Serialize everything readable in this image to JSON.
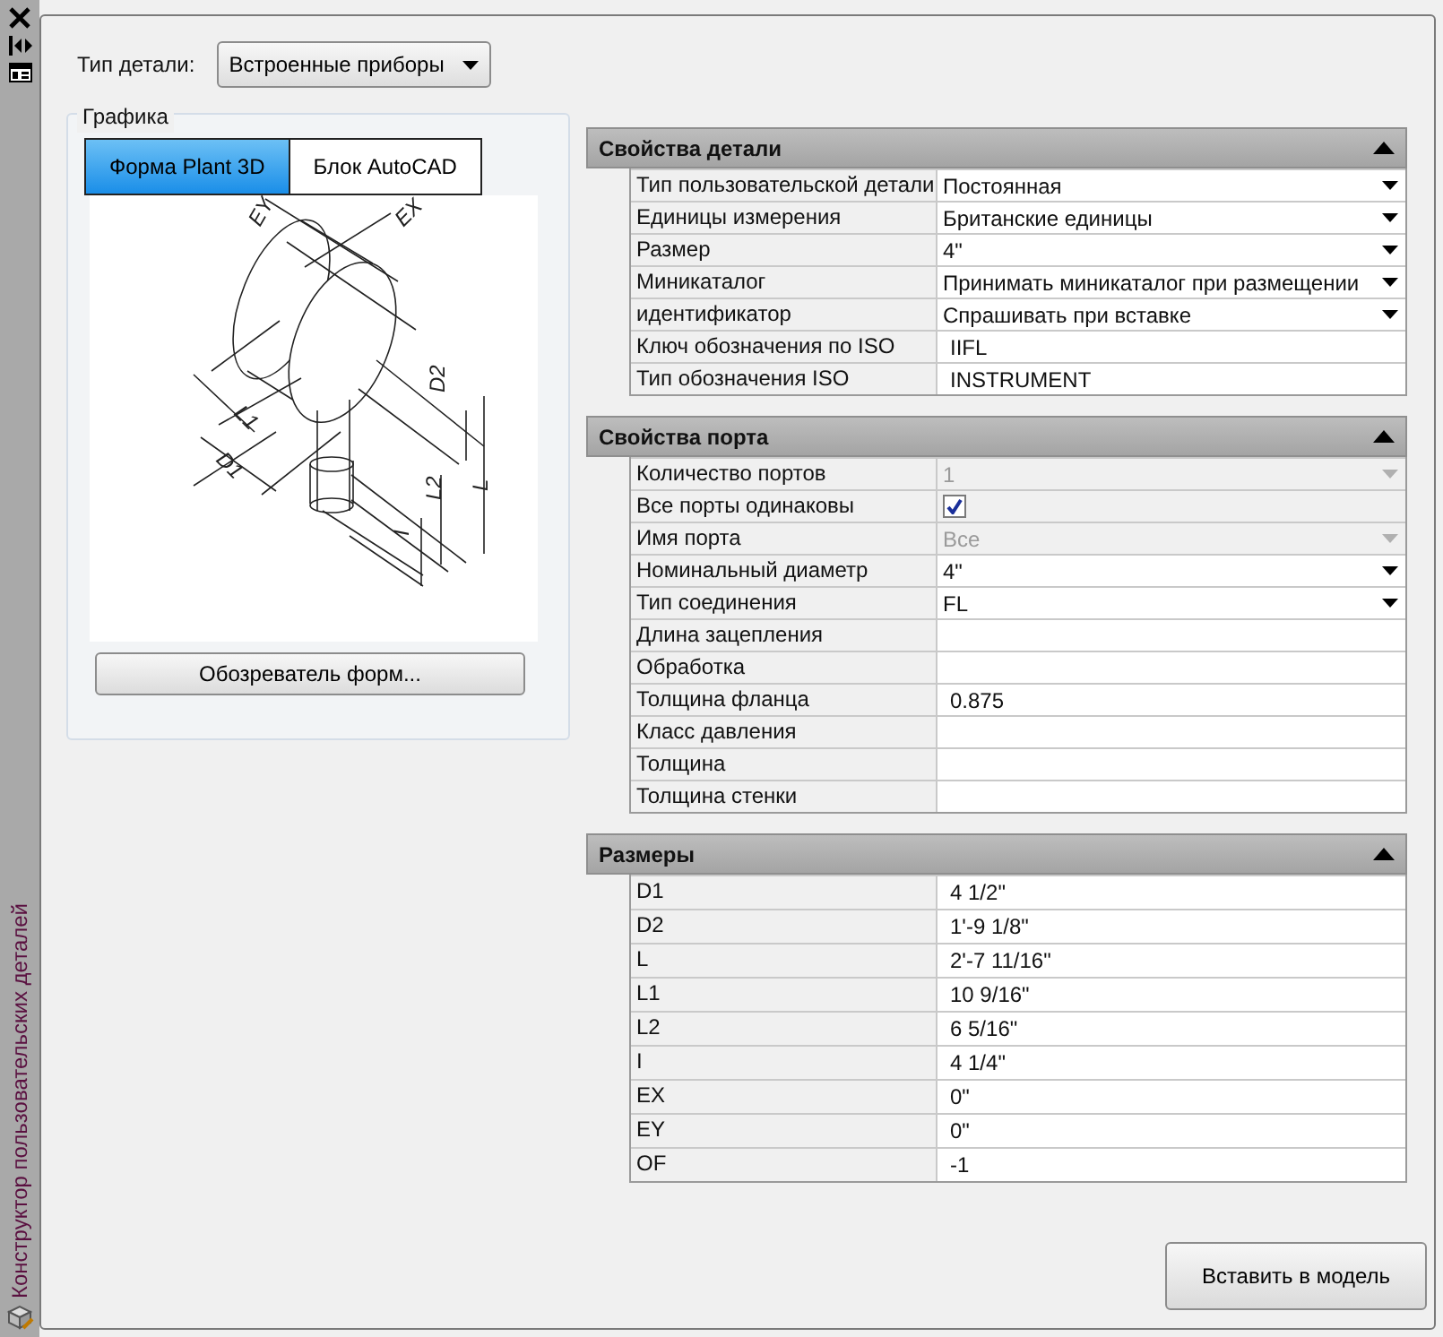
{
  "side_panel": {
    "title": "Конструктор пользовательских деталей"
  },
  "part_type": {
    "label": "Тип детали:",
    "value": "Встроенные приборы"
  },
  "graphics": {
    "title": "Графика",
    "tabs": [
      {
        "label": "Форма Plant 3D",
        "selected": true
      },
      {
        "label": "Блок AutoCAD",
        "selected": false
      }
    ],
    "dimension_labels": [
      "EY",
      "EX",
      "L1",
      "D1",
      "D2",
      "L",
      "L2",
      "I"
    ],
    "button": "Обозреватель форм..."
  },
  "sections": [
    {
      "title": "Свойства детали",
      "expanded": true,
      "rows": [
        {
          "label": "Тип пользовательской детали",
          "value": "Постоянная",
          "kind": "dropdown",
          "disabled": false
        },
        {
          "label": "Единицы измерения",
          "value": "Британские единицы",
          "kind": "dropdown",
          "disabled": false
        },
        {
          "label": "Размер",
          "value": "4\"",
          "kind": "dropdown",
          "disabled": false
        },
        {
          "label": "Миникаталог",
          "value": "Принимать миникаталог при размещении",
          "kind": "dropdown",
          "disabled": false
        },
        {
          "label": "идентификатор",
          "value": "Спрашивать при вставке",
          "kind": "dropdown",
          "disabled": false
        },
        {
          "label": "Ключ обозначения по ISO",
          "value": "IIFL",
          "kind": "text",
          "disabled": false
        },
        {
          "label": "Тип обозначения ISO",
          "value": "INSTRUMENT",
          "kind": "text",
          "disabled": false
        }
      ]
    },
    {
      "title": "Свойства порта",
      "expanded": true,
      "rows": [
        {
          "label": "Количество портов",
          "value": "1",
          "kind": "dropdown",
          "disabled": true
        },
        {
          "label": "Все порты одинаковы",
          "kind": "checkbox",
          "checked": true,
          "disabled": false
        },
        {
          "label": "Имя порта",
          "value": "Все",
          "kind": "dropdown",
          "disabled": true
        },
        {
          "label": "Номинальный диаметр",
          "value": "4\"",
          "kind": "dropdown",
          "disabled": false
        },
        {
          "label": "Тип соединения",
          "value": "FL",
          "kind": "dropdown",
          "disabled": false
        },
        {
          "label": "Длина зацепления",
          "kind": "text",
          "disabled": false
        },
        {
          "label": "Обработка",
          "kind": "text",
          "disabled": false
        },
        {
          "label": "Толщина фланца",
          "value": "0.875",
          "kind": "text",
          "disabled": false
        },
        {
          "label": "Класс давления",
          "kind": "text",
          "disabled": false
        },
        {
          "label": "Толщина",
          "kind": "text",
          "disabled": false
        },
        {
          "label": "Толщина стенки",
          "kind": "text",
          "disabled": false
        }
      ]
    },
    {
      "title": "Размеры",
      "expanded": true,
      "rows": [
        {
          "label": "D1",
          "value": "4 1/2\"",
          "kind": "text",
          "disabled": false
        },
        {
          "label": "D2",
          "value": "1'-9 1/8\"",
          "kind": "text",
          "disabled": false
        },
        {
          "label": "L",
          "value": "2'-7 11/16\"",
          "kind": "text",
          "disabled": false
        },
        {
          "label": "L1",
          "value": "10 9/16\"",
          "kind": "text",
          "disabled": false
        },
        {
          "label": "L2",
          "value": "6 5/16\"",
          "kind": "text",
          "disabled": false
        },
        {
          "label": "I",
          "value": "4 1/4\"",
          "kind": "text",
          "disabled": false
        },
        {
          "label": "EX",
          "value": "0\"",
          "kind": "text",
          "disabled": false
        },
        {
          "label": "EY",
          "value": "0\"",
          "kind": "text",
          "disabled": false
        },
        {
          "label": "OF",
          "value": "-1",
          "kind": "text",
          "disabled": false
        }
      ]
    }
  ],
  "insert_button": "Вставить в модель"
}
